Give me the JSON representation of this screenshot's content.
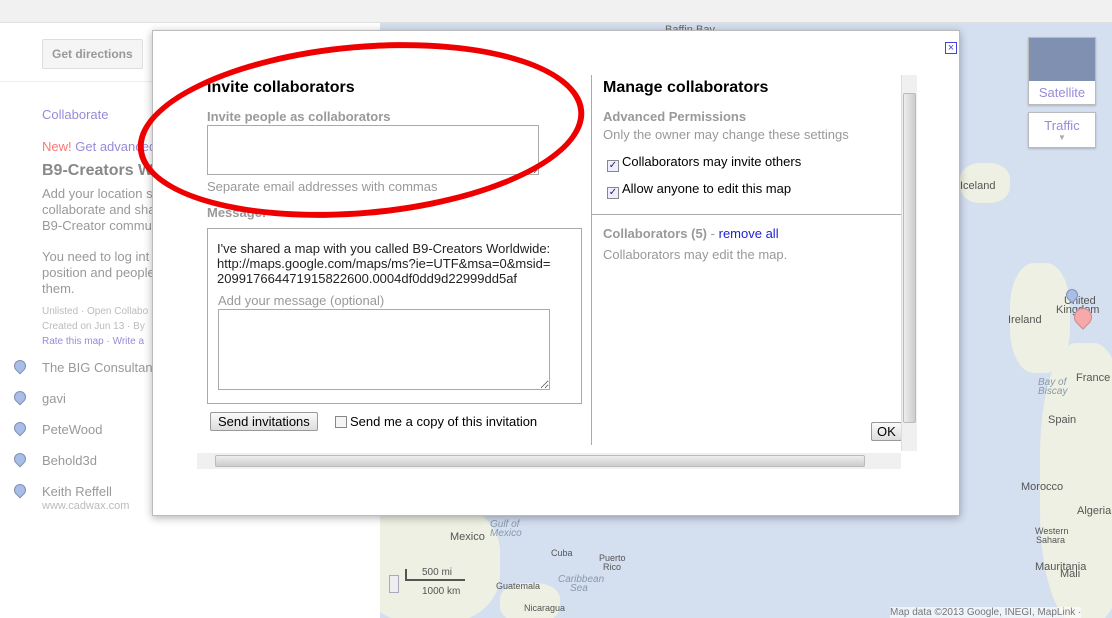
{
  "sidebar": {
    "get_directions": "Get directions",
    "collaborate": "Collaborate",
    "new_badge": "New!",
    "get_advanced": "Get advanced",
    "map_title": "B9-Creators W",
    "desc": [
      "Add your location s",
      "collaborate and sha",
      "B9-Creator commu"
    ],
    "login_note": [
      "You need to log int",
      "position and people",
      "them."
    ],
    "meta1": "Unlisted · Open Collabo",
    "meta2": "Created on Jun 13 · By",
    "rate": "Rate this map · Write a",
    "places": [
      "The BIG Consultan",
      "gavi",
      "PeteWood",
      "Behold3d",
      "Keith Reffell"
    ],
    "website": "www.cadwax.com"
  },
  "dialog": {
    "invite_title": "Invite collaborators",
    "invite_label": "Invite people as collaborators",
    "email_value": "",
    "email_hint": "Separate email addresses with commas",
    "message_label": "Message:",
    "message_lines": [
      "I've shared a map with you called B9-Creators Worldwide:",
      "http://maps.google.com/maps/ms?ie=UTF&msa=0&msid=",
      "209917664471915822600.0004df0dd9d22999dd5af"
    ],
    "add_message_label": "Add your message (optional)",
    "add_message_value": "",
    "send_button": "Send invitations",
    "copy_label": "Send me a copy of this invitation",
    "copy_checked": false,
    "manage_title": "Manage collaborators",
    "adv_perm": "Advanced Permissions",
    "owner_note": "Only the owner may change these settings",
    "perm_invite": "Collaborators may invite others",
    "perm_invite_checked": true,
    "perm_edit": "Allow anyone to edit this map",
    "perm_edit_checked": true,
    "collab_count": "Collaborators (5)",
    "remove_all": "remove all",
    "collab_note": "Collaborators may edit the map.",
    "ok": "OK",
    "close_icon": "close-icon"
  },
  "map": {
    "satellite": "Satellite",
    "traffic": "Traffic",
    "labels": {
      "baffin": "Baffin Bay",
      "iceland": "Iceland",
      "ireland": "Ireland",
      "uk1": "United",
      "uk2": "Kingdom",
      "france": "France",
      "biscay1": "Bay of",
      "biscay2": "Biscay",
      "spain": "Spain",
      "morocco": "Morocco",
      "algeria": "Algeria",
      "wsahara1": "Western",
      "wsahara2": "Sahara",
      "mauritania": "Mauritania",
      "mali": "Mali",
      "mexico": "Mexico",
      "gulf1": "Gulf of",
      "gulf2": "Mexico",
      "cuba": "Cuba",
      "pr1": "Puerto",
      "pr2": "Rico",
      "carib1": "Caribbean",
      "carib2": "Sea",
      "guatemala": "Guatemala",
      "nicaragua": "Nicaragua"
    },
    "scale_mi": "500 mi",
    "scale_km": "1000 km",
    "attribution": "Map data ©2013 Google, INEGI, MapLink ·"
  },
  "colors": {
    "annotation": "#e00000",
    "link": "#9a8ad8",
    "map_water": "#d4dff0"
  }
}
